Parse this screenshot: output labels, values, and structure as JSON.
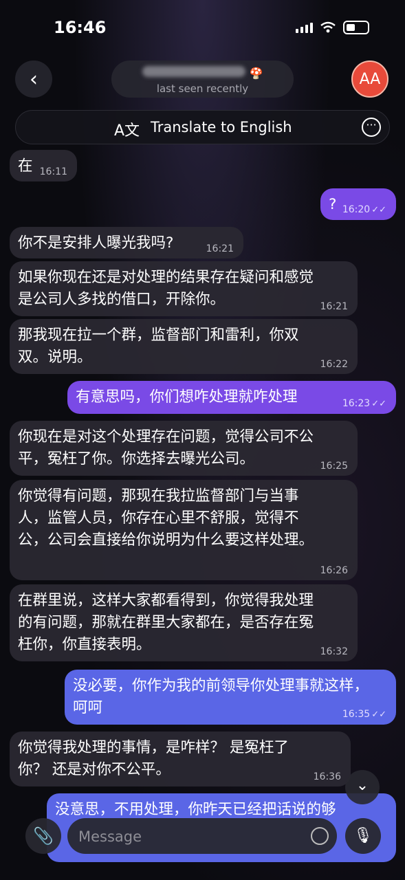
{
  "status_bar": {
    "time": "16:46"
  },
  "header": {
    "back_icon": "‹",
    "subtitle": "last seen recently",
    "title_emoji": "🍄",
    "avatar_initials": "AA"
  },
  "translate_bar": {
    "icon": "A文",
    "label": "Translate to English",
    "more_icon": "···"
  },
  "messages": [
    {
      "text": "在",
      "time": "16:11",
      "direction": "in"
    },
    {
      "text": "?",
      "time": "16:20",
      "direction": "out"
    },
    {
      "text": "你不是安排人曝光我吗?",
      "time": "16:21",
      "direction": "in"
    },
    {
      "text": "如果你现在还是对处理的结果存在疑问和感觉是公司人多找的借口，开除你。",
      "time": "16:21",
      "direction": "in"
    },
    {
      "text": "那我现在拉一个群，监督部门和雷利，你双双。说明。",
      "time": "16:22",
      "direction": "in"
    },
    {
      "text": "有意思吗，你们想咋处理就咋处理",
      "time": "16:23",
      "direction": "out"
    },
    {
      "text": "你现在是对这个处理存在问题，觉得公司不公平，冤枉了你。你选择去曝光公司。",
      "time": "16:25",
      "direction": "in"
    },
    {
      "text": "你觉得有问题，那现在我拉监督部门与当事人，监管人员，你存在心里不舒服，觉得不公，公司会直接给你说明为什么要这样处理。",
      "time": "16:26",
      "direction": "in"
    },
    {
      "text": "在群里说，这样大家都看得到，你觉得我处理的有问题，那就在群里大家都在，是否存在冤枉你，你直接表明。",
      "time": "16:32",
      "direction": "in"
    },
    {
      "text": "没必要，你作为我的前领导你处理事就这样，呵呵",
      "time": "16:35",
      "direction": "out"
    },
    {
      "text": "你觉得我处理的事情，是咋样？ 是冤枉了你？ 还是对你不公平。",
      "time": "16:36",
      "direction": "in"
    },
    {
      "text": "没意思，不用处理，你昨天已经把话说的够",
      "time": "",
      "direction": "out"
    }
  ],
  "read_check": "✓✓",
  "scroll_down_icon": "⌄",
  "composer": {
    "placeholder": "Message",
    "attach_icon": "📎",
    "mic_icon": "🎙"
  },
  "colors": {
    "outgoing_bubble": "#7a4ae6",
    "incoming_bubble": "#2a2832",
    "avatar": "#e84a3a"
  }
}
